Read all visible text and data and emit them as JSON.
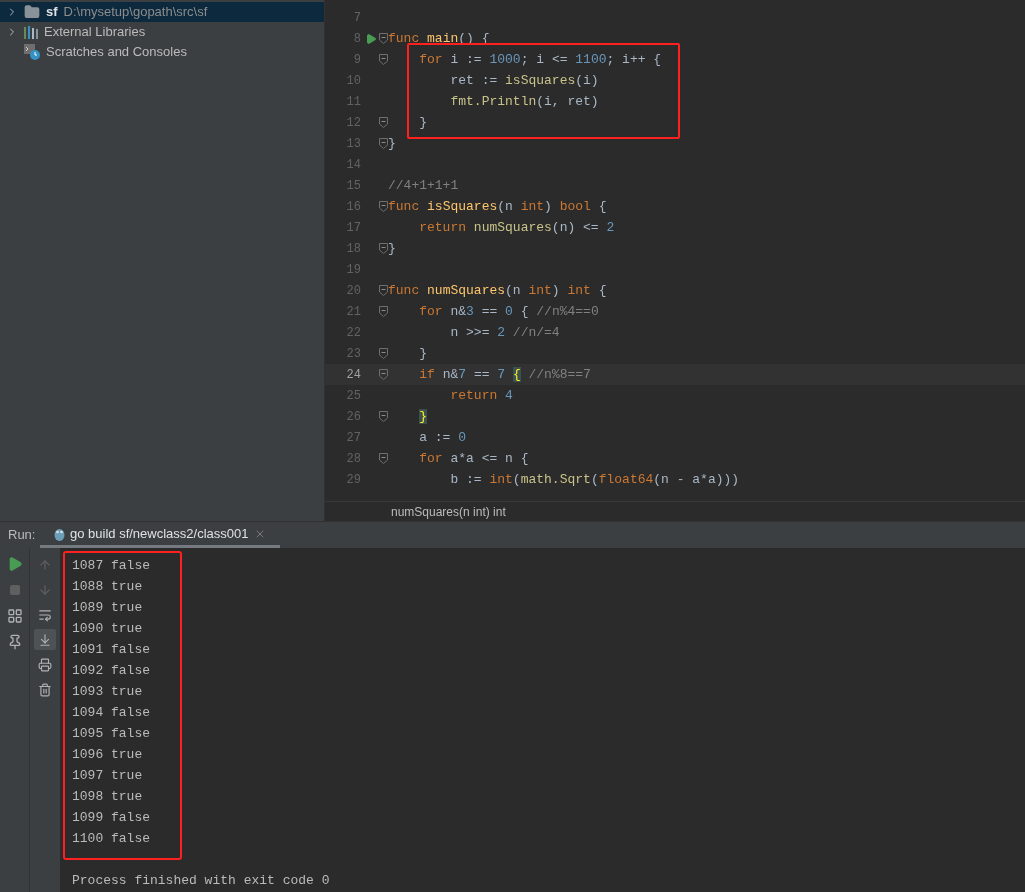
{
  "project_tree": [
    {
      "kind": "folder",
      "name": "sf",
      "path": "D:\\mysetup\\gopath\\src\\sf",
      "expandable": true,
      "selected": true
    },
    {
      "kind": "libraries",
      "name": "External Libraries",
      "expandable": true,
      "selected": false
    },
    {
      "kind": "scratches",
      "name": "Scratches and Consoles",
      "expandable": false,
      "selected": false
    }
  ],
  "editor": {
    "lines": [
      {
        "number": "7",
        "fold": false,
        "run": false,
        "current": false
      },
      {
        "number": "8",
        "tokens": [
          {
            "kind": "kw",
            "text": "func"
          },
          {
            "kind": "fn",
            "text": " main"
          },
          {
            "kind": "plain",
            "text": "() {"
          }
        ],
        "fold": true,
        "run": true,
        "current": false
      },
      {
        "number": "9",
        "tokens": [
          {
            "kind": "kw",
            "text": "    for"
          },
          {
            "kind": "plain",
            "text": " i := "
          },
          {
            "kind": "num",
            "text": "1000"
          },
          {
            "kind": "plain",
            "text": "; i <= "
          },
          {
            "kind": "num",
            "text": "1100"
          },
          {
            "kind": "plain",
            "text": "; i++ {"
          }
        ],
        "fold": true,
        "run": false,
        "current": false
      },
      {
        "number": "10",
        "tokens": [
          {
            "kind": "plain",
            "text": "        ret := "
          },
          {
            "kind": "call",
            "text": "isSquares"
          },
          {
            "kind": "plain",
            "text": "(i)"
          }
        ],
        "fold": false,
        "run": false,
        "current": false
      },
      {
        "number": "11",
        "tokens": [
          {
            "kind": "call",
            "text": "        fmt.Println"
          },
          {
            "kind": "plain",
            "text": "(i, ret)"
          }
        ],
        "fold": false,
        "run": false,
        "current": false
      },
      {
        "number": "12",
        "tokens": [
          {
            "kind": "plain",
            "text": "    }"
          }
        ],
        "fold": true,
        "run": false,
        "current": false
      },
      {
        "number": "13",
        "tokens": [
          {
            "kind": "plain",
            "text": "}"
          }
        ],
        "fold": true,
        "run": false,
        "current": false
      },
      {
        "number": "14",
        "fold": false,
        "run": false,
        "current": false
      },
      {
        "number": "15",
        "tokens": [
          {
            "kind": "comment",
            "text": "//4+1+1+1"
          }
        ],
        "fold": false,
        "run": false,
        "current": false
      },
      {
        "number": "16",
        "tokens": [
          {
            "kind": "kw",
            "text": "func"
          },
          {
            "kind": "fn",
            "text": " isSquares"
          },
          {
            "kind": "plain",
            "text": "(n "
          },
          {
            "kind": "type",
            "text": "int"
          },
          {
            "kind": "plain",
            "text": ") "
          },
          {
            "kind": "type",
            "text": "bool"
          },
          {
            "kind": "plain",
            "text": " {"
          }
        ],
        "fold": true,
        "run": false,
        "current": false
      },
      {
        "number": "17",
        "tokens": [
          {
            "kind": "kw",
            "text": "    return"
          },
          {
            "kind": "call",
            "text": " numSquares"
          },
          {
            "kind": "plain",
            "text": "(n) <= "
          },
          {
            "kind": "num",
            "text": "2"
          }
        ],
        "fold": false,
        "run": false,
        "current": false
      },
      {
        "number": "18",
        "tokens": [
          {
            "kind": "plain",
            "text": "}"
          }
        ],
        "fold": true,
        "run": false,
        "current": false
      },
      {
        "number": "19",
        "fold": false,
        "run": false,
        "current": false
      },
      {
        "number": "20",
        "tokens": [
          {
            "kind": "kw",
            "text": "func"
          },
          {
            "kind": "fn",
            "text": " numSquares"
          },
          {
            "kind": "plain",
            "text": "(n "
          },
          {
            "kind": "type",
            "text": "int"
          },
          {
            "kind": "plain",
            "text": ") "
          },
          {
            "kind": "type",
            "text": "int"
          },
          {
            "kind": "plain",
            "text": " {"
          }
        ],
        "fold": true,
        "run": false,
        "current": false
      },
      {
        "number": "21",
        "tokens": [
          {
            "kind": "kw",
            "text": "    for"
          },
          {
            "kind": "plain",
            "text": " n&"
          },
          {
            "kind": "num",
            "text": "3"
          },
          {
            "kind": "plain",
            "text": " == "
          },
          {
            "kind": "num",
            "text": "0"
          },
          {
            "kind": "plain",
            "text": " { "
          },
          {
            "kind": "comment",
            "text": "//n%4==0"
          }
        ],
        "fold": true,
        "run": false,
        "current": false
      },
      {
        "number": "22",
        "tokens": [
          {
            "kind": "plain",
            "text": "        n >>= "
          },
          {
            "kind": "num",
            "text": "2"
          },
          {
            "kind": "comment",
            "text": " //n/=4"
          }
        ],
        "fold": false,
        "run": false,
        "current": false
      },
      {
        "number": "23",
        "tokens": [
          {
            "kind": "plain",
            "text": "    }"
          }
        ],
        "fold": true,
        "run": false,
        "current": false
      },
      {
        "number": "24",
        "tokens": [
          {
            "kind": "kw",
            "text": "    if"
          },
          {
            "kind": "plain",
            "text": " n&"
          },
          {
            "kind": "num",
            "text": "7"
          },
          {
            "kind": "plain",
            "text": " == "
          },
          {
            "kind": "num",
            "text": "7 "
          },
          {
            "kind": "brace",
            "text": "{"
          },
          {
            "kind": "comment",
            "text": " //n%8==7"
          }
        ],
        "fold": true,
        "run": false,
        "current": true
      },
      {
        "number": "25",
        "tokens": [
          {
            "kind": "kw",
            "text": "        return"
          },
          {
            "kind": "num",
            "text": " 4"
          }
        ],
        "fold": false,
        "run": false,
        "current": false
      },
      {
        "number": "26",
        "tokens": [
          {
            "kind": "brace",
            "text": "    }"
          }
        ],
        "fold": true,
        "run": false,
        "current": false
      },
      {
        "number": "27",
        "tokens": [
          {
            "kind": "plain",
            "text": "    a := "
          },
          {
            "kind": "num",
            "text": "0"
          }
        ],
        "fold": false,
        "run": false,
        "current": false
      },
      {
        "number": "28",
        "tokens": [
          {
            "kind": "kw",
            "text": "    for"
          },
          {
            "kind": "plain",
            "text": " a*a <= n {"
          }
        ],
        "fold": true,
        "run": false,
        "current": false
      },
      {
        "number": "29",
        "tokens": [
          {
            "kind": "plain",
            "text": "        b := "
          },
          {
            "kind": "type",
            "text": "int"
          },
          {
            "kind": "plain",
            "text": "("
          },
          {
            "kind": "call",
            "text": "math.Sqrt"
          },
          {
            "kind": "plain",
            "text": "("
          },
          {
            "kind": "type",
            "text": "float64"
          },
          {
            "kind": "plain",
            "text": "(n - a*a)))"
          }
        ],
        "fold": false,
        "run": false,
        "current": false
      }
    ],
    "breadcrumb": "numSquares(n int) int"
  },
  "run_panel": {
    "label": "Run:",
    "tab": {
      "title": "go build sf/newclass2/class001",
      "selected": true
    },
    "side_tools": [
      {
        "kind": "rerun",
        "disabled": false
      },
      {
        "kind": "stop",
        "disabled": true
      },
      {
        "kind": "layout",
        "disabled": false
      },
      {
        "kind": "pin",
        "disabled": false
      }
    ],
    "tools": [
      {
        "kind": "up",
        "disabled": true,
        "selected": false
      },
      {
        "kind": "down",
        "disabled": true,
        "selected": false
      },
      {
        "kind": "wrap",
        "disabled": false,
        "selected": false
      },
      {
        "kind": "scroll-end",
        "disabled": false,
        "selected": true
      },
      {
        "kind": "print",
        "disabled": false,
        "selected": false
      },
      {
        "kind": "trash",
        "disabled": false,
        "selected": false
      }
    ],
    "output": [
      "1087 false",
      "1088 true",
      "1089 true",
      "1090 true",
      "1091 false",
      "1092 false",
      "1093 true",
      "1094 false",
      "1095 false",
      "1096 true",
      "1097 true",
      "1098 true",
      "1099 false",
      "1100 false"
    ],
    "footer": "Process finished with exit code 0"
  }
}
